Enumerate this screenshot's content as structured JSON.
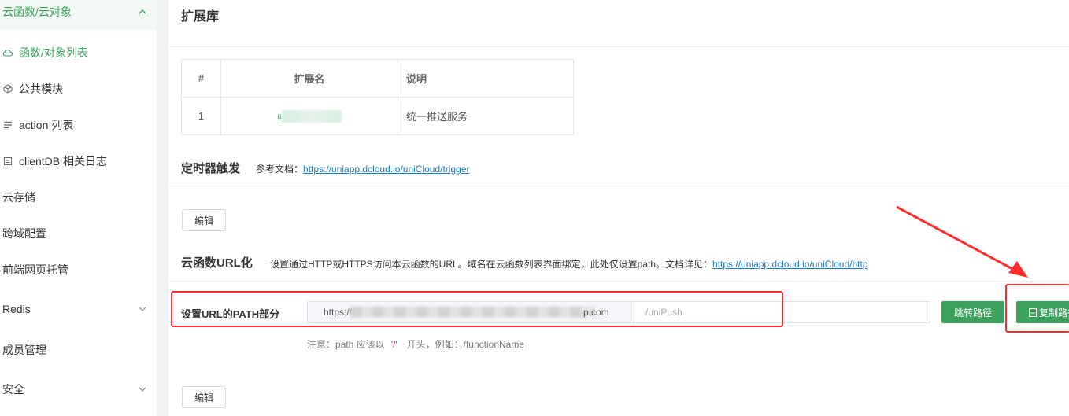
{
  "sidebar": {
    "items": [
      {
        "label": "云函数/云对象",
        "icon": "chevron-up-icon"
      },
      {
        "label": "函数/对象列表",
        "icon": "cloud-icon"
      },
      {
        "label": "公共模块",
        "icon": "cube-icon"
      },
      {
        "label": "action 列表",
        "icon": "list-icon"
      },
      {
        "label": "clientDB 相关日志",
        "icon": "document-icon"
      },
      {
        "label": "云存储"
      },
      {
        "label": "跨域配置"
      },
      {
        "label": "前端网页托管"
      },
      {
        "label": "Redis",
        "icon": "chevron-down-icon"
      },
      {
        "label": "成员管理"
      },
      {
        "label": "安全",
        "icon": "chevron-down-icon"
      }
    ]
  },
  "extensions": {
    "title": "扩展库",
    "headers": [
      "#",
      "扩展名",
      "说明"
    ],
    "rows": [
      {
        "index": "1",
        "name": "u",
        "desc": "统一推送服务"
      }
    ]
  },
  "timer": {
    "title": "定时器触发",
    "doc_prefix": "参考文档：",
    "doc_link": "https://uniapp.dcloud.io/uniCloud/trigger",
    "edit_label": "编辑"
  },
  "url_section": {
    "title": "云函数URL化",
    "doc_prefix": "设置通过HTTP或HTTPS访问本云函数的URL。域名在云函数列表界面绑定，此处仅设置path。文档详见：",
    "doc_link": "https://uniapp.dcloud.io/uniCloud/http",
    "path_label": "设置URL的PATH部分",
    "url_prefix_start": "https://f",
    "url_prefix_end": "p.com",
    "path_placeholder": "/uniPush",
    "jump_label": "跳转路径",
    "copy_label": "复制路径",
    "hint_text": "注意：path 应该以",
    "hint_slash": "'/'",
    "hint_rest": "开头，例如：/functionName",
    "edit_label": "编辑"
  },
  "colors": {
    "accent": "#3ea05f",
    "annotation": "#ff2d2d",
    "link": "#1e7ac6"
  }
}
